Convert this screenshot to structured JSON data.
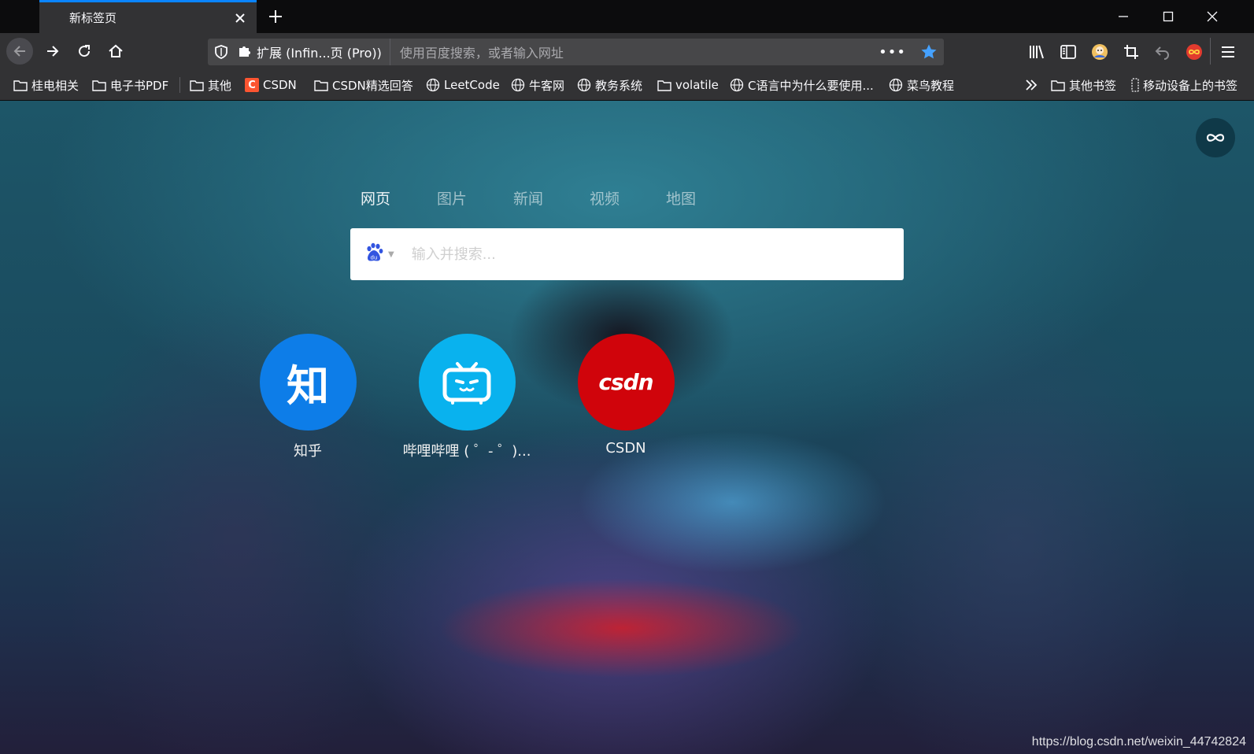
{
  "tab": {
    "title": "新标签页"
  },
  "navbar": {
    "ext_label": "扩展 (Infin...页 (Pro))",
    "url_placeholder": "使用百度搜索，或者输入网址",
    "more_dots": "•••"
  },
  "bookmarks": {
    "items": [
      {
        "label": "桂电相关",
        "icon": "folder-icon"
      },
      {
        "label": "电子书PDF",
        "icon": "folder-icon"
      },
      {
        "label": "其他",
        "icon": "folder-icon"
      },
      {
        "label": "CSDN",
        "icon": "csdn-icon"
      },
      {
        "label": "CSDN精选回答",
        "icon": "folder-icon"
      },
      {
        "label": "LeetCode",
        "icon": "globe-icon"
      },
      {
        "label": "牛客网",
        "icon": "globe-icon"
      },
      {
        "label": "教务系统",
        "icon": "globe-icon"
      },
      {
        "label": "volatile",
        "icon": "folder-icon"
      },
      {
        "label": "C语言中为什么要使用...",
        "icon": "globe-icon"
      },
      {
        "label": "菜鸟教程",
        "icon": "globe-icon"
      }
    ],
    "other": "其他书签",
    "mobile": "移动设备上的书签",
    "csdn_glyph": "C"
  },
  "search": {
    "tabs": [
      "网页",
      "图片",
      "新闻",
      "视频",
      "地图"
    ],
    "active_tab": "网页",
    "placeholder": "输入并搜索...",
    "engine": "baidu",
    "engine_caret": "▼"
  },
  "shortcuts": [
    {
      "label": "知乎",
      "glyph": "知",
      "color": "#0d7de8"
    },
    {
      "label": "哔哩哔哩 ( ゜- ゜)...",
      "color": "#09b2ee"
    },
    {
      "label": "CSDN",
      "glyph": "csdn",
      "color": "#d0040b"
    }
  ],
  "watermark": "https://blog.csdn.net/weixin_44742824",
  "colors": {
    "accent": "#0a84ff",
    "bookmark_star": "#45a1ff",
    "chrome": "#323234"
  }
}
